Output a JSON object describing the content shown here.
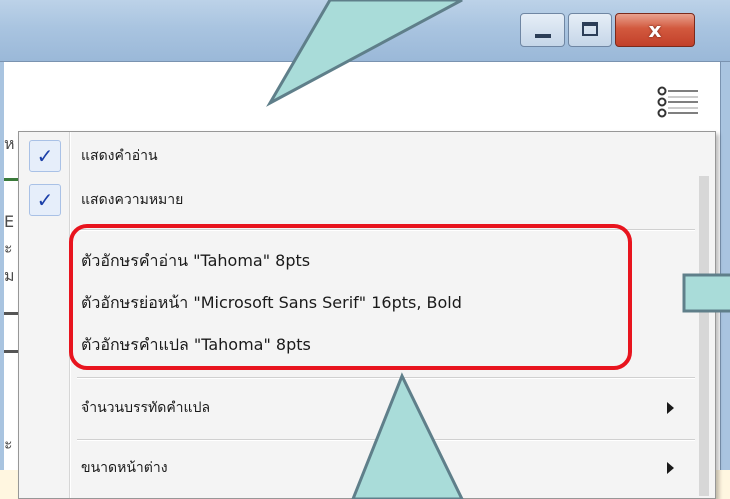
{
  "colors": {
    "titlebar": "#a9c4e0",
    "highlight_border": "#e8141e",
    "callout_fill": "#a9dcd9",
    "callout_stroke": "#5f7f8a",
    "check": "#1b3fa8"
  },
  "window": {
    "buttons": [
      {
        "name": "minimize",
        "icon": "minimize-icon"
      },
      {
        "name": "maximize",
        "icon": "maximize-icon"
      },
      {
        "name": "close",
        "icon": "close-icon",
        "glyph": "x"
      }
    ],
    "menu_button_icon": "list-menu-icon"
  },
  "menu": {
    "items": [
      {
        "label": "แสดงคำอ่าน",
        "checked": true,
        "check_glyph": "✓"
      },
      {
        "label": "แสดงความหมาย",
        "checked": true,
        "check_glyph": "✓"
      },
      {
        "label": "ตัวอักษรคำอ่าน \"Tahoma\" 8pts"
      },
      {
        "label": "ตัวอักษรย่อหน้า \"Microsoft Sans Serif\" 16pts, Bold"
      },
      {
        "label": "ตัวอักษรคำแปล \"Tahoma\" 8pts"
      },
      {
        "label": "จำนวนบรรทัดคำแปล",
        "submenu": true
      },
      {
        "label": "ขนาดหน้าต่าง",
        "submenu": true
      }
    ]
  },
  "background": {
    "fragments": [
      "ห",
      "E",
      "ะ",
      "ม",
      "ะ"
    ]
  }
}
